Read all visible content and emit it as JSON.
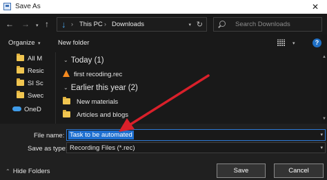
{
  "window": {
    "title": "Save As",
    "close_glyph": "✕"
  },
  "nav": {
    "back_glyph": "←",
    "forward_glyph": "→",
    "recent_glyph": "▾",
    "up_glyph": "↑",
    "address": {
      "crumbs": [
        "This PC",
        "Downloads"
      ],
      "separator": "›",
      "dropdown_glyph": "▾",
      "refresh_glyph": "↻"
    },
    "search": {
      "placeholder": "Search Downloads"
    }
  },
  "toolbar": {
    "organize_label": "Organize",
    "organize_caret": "▾",
    "new_folder_label": "New folder",
    "view_caret": "▾",
    "help_glyph": "?"
  },
  "sidebar": {
    "items": [
      {
        "label": "All M"
      },
      {
        "label": "Resic"
      },
      {
        "label": "SI Sc"
      },
      {
        "label": "Swec"
      }
    ],
    "onedrive_label": "OneD"
  },
  "filelist": {
    "groups": [
      {
        "header": "Today (1)",
        "files": [
          {
            "name": "first recoding.rec",
            "icon": "vlc-icon"
          }
        ]
      },
      {
        "header": "Earlier this year (2)",
        "files": [
          {
            "name": "New materials",
            "icon": "folder-icon"
          },
          {
            "name": "Articles and blogs",
            "icon": "folder-icon"
          }
        ]
      }
    ],
    "group_chevron": "⌄"
  },
  "form": {
    "file_name_label": "File name:",
    "file_name_value": "Task to be automated",
    "save_as_type_label": "Save as type:",
    "save_as_type_value": "Recording Files (*.rec)",
    "dropdown_caret": "▾"
  },
  "footer": {
    "hide_folders_label": "Hide Folders",
    "hide_chevron": "⌃",
    "save_label": "Save",
    "cancel_label": "Cancel"
  },
  "colors": {
    "accent": "#1e6fd0",
    "arrow": "#d9202a",
    "background": "#191919"
  }
}
